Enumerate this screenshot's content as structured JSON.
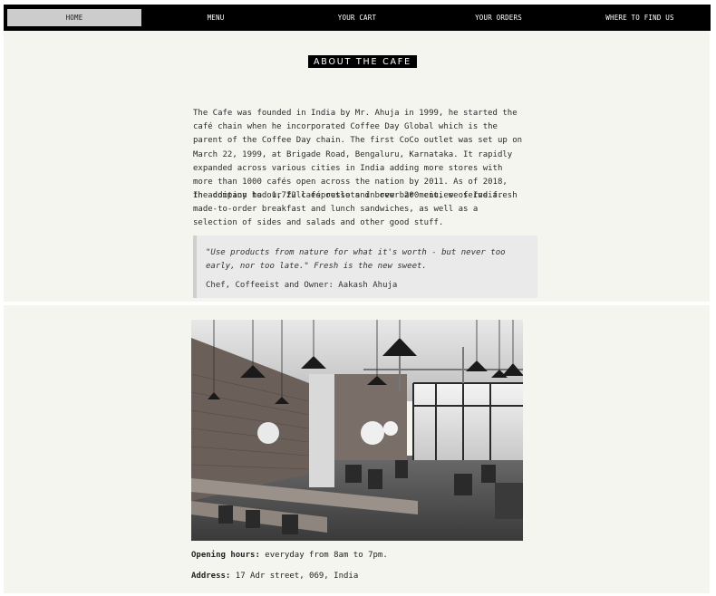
{
  "nav": {
    "items": [
      {
        "label": "HOME",
        "active": true
      },
      {
        "label": "MENU"
      },
      {
        "label": "YOUR CART"
      },
      {
        "label": "YOUR ORDERS"
      },
      {
        "label": "WHERE TO FIND US"
      }
    ]
  },
  "about": {
    "title": "ABOUT THE CAFE",
    "paragraph1": "The Cafe was founded in India by Mr. Ahuja in 1999, he started the café chain when he incorporated Coffee Day Global which is the parent of the Coffee Day chain. The first CoCo outlet was set up on March 22, 1999, at Brigade Road, Bengaluru, Karnataka. It rapidly expanded across various cities in India adding more stores with more than 1000 cafés open across the nation by 2011. As of 2018, the company had 1,722 café outlets in over 200 cities of India.",
    "paragraph2": "In addition to our full espresso and brew bar menu, we serve fresh made-to-order breakfast and lunch sandwiches, as well as a selection of sides and salads and other good stuff.",
    "quote": {
      "text": "\"Use products from nature for what it's worth - but never too early, nor too late.\" Fresh is the new sweet.",
      "author": "Chef, Coffeeist and Owner: Aakash Ahuja"
    }
  },
  "info": {
    "hours_label": "Opening hours:",
    "hours_value": " everyday from 8am to 7pm.",
    "address_label": "Address:",
    "address_value": " 17 Adr street, 069, India"
  },
  "colors": {
    "nav_bg": "#000000",
    "nav_active_bg": "#cccccc",
    "section_bg": "#f5f5f0",
    "quote_bg": "#eaeaea"
  }
}
